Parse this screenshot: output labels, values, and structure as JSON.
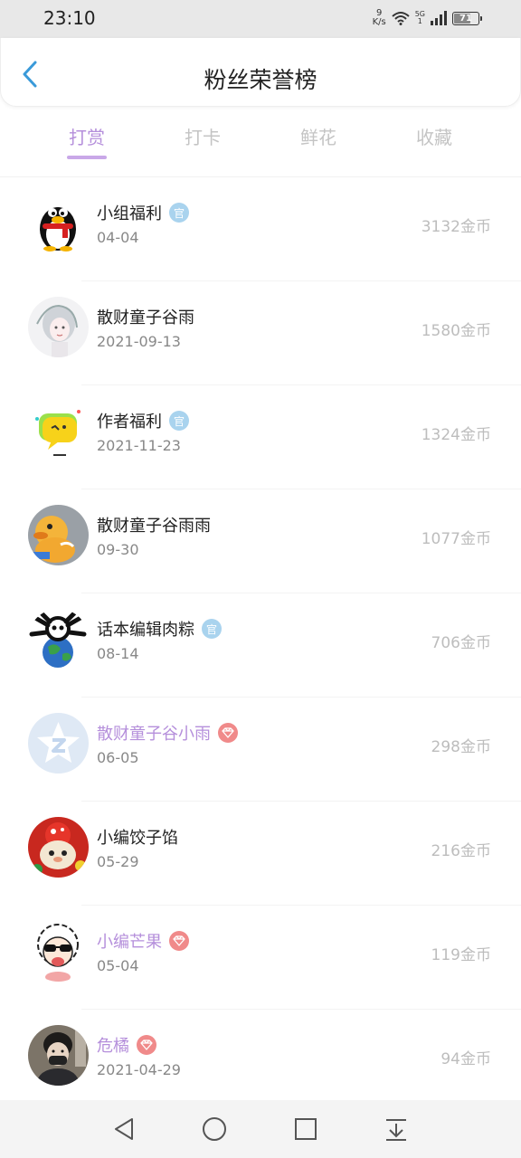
{
  "status_bar": {
    "time": "23:10",
    "net_speed_value": "9",
    "net_speed_unit": "K/s",
    "signal_label_top": "5G",
    "signal_label_bottom": "1",
    "battery": "71",
    "battery_level_percent": 71
  },
  "header": {
    "title": "粉丝荣誉榜",
    "back_icon": "chevron-left-icon"
  },
  "tabs": [
    {
      "label": "打赏",
      "active": true
    },
    {
      "label": "打卡",
      "active": false
    },
    {
      "label": "鲜花",
      "active": false
    },
    {
      "label": "收藏",
      "active": false
    }
  ],
  "colors": {
    "accent_purple": "#b58fdb",
    "official_badge": "#a9d3ee",
    "diamond_badge": "#f08a8a",
    "back_arrow": "#3a9ad9"
  },
  "badge_text": {
    "official": "官"
  },
  "fans": [
    {
      "name": "小组福利",
      "date": "04-04",
      "coins": "3132金币",
      "badge": "official",
      "vip": false,
      "avatar": "penguin-avatar"
    },
    {
      "name": "散财童子谷雨",
      "date": "2021-09-13",
      "coins": "1580金币",
      "badge": "",
      "vip": false,
      "avatar": "girl-sketch-avatar"
    },
    {
      "name": "作者福利",
      "date": "2021-11-23",
      "coins": "1324金币",
      "badge": "official",
      "vip": false,
      "avatar": "chat-bubble-avatar"
    },
    {
      "name": "散财童子谷雨雨",
      "date": "09-30",
      "coins": "1077金币",
      "badge": "",
      "vip": false,
      "avatar": "duck-avatar"
    },
    {
      "name": "话本编辑肉粽",
      "date": "08-14",
      "coins": "706金币",
      "badge": "official",
      "vip": false,
      "avatar": "earth-creature-avatar"
    },
    {
      "name": "散财童子谷小雨",
      "date": "06-05",
      "coins": "298金币",
      "badge": "diamond",
      "vip": true,
      "avatar": "default-star-avatar"
    },
    {
      "name": "小编饺子馅",
      "date": "05-29",
      "coins": "216金币",
      "badge": "",
      "vip": false,
      "avatar": "plush-toy-avatar"
    },
    {
      "name": "小编芒果",
      "date": "05-04",
      "coins": "119金币",
      "badge": "diamond",
      "vip": true,
      "avatar": "sheep-sunglasses-avatar"
    },
    {
      "name": "危橘",
      "date": "2021-04-29",
      "coins": "94金币",
      "badge": "diamond",
      "vip": true,
      "avatar": "masked-person-avatar"
    }
  ],
  "nav_bar": {
    "back": "triangle-back-icon",
    "home": "circle-home-icon",
    "recents": "square-recents-icon",
    "notifications": "pull-down-icon"
  }
}
